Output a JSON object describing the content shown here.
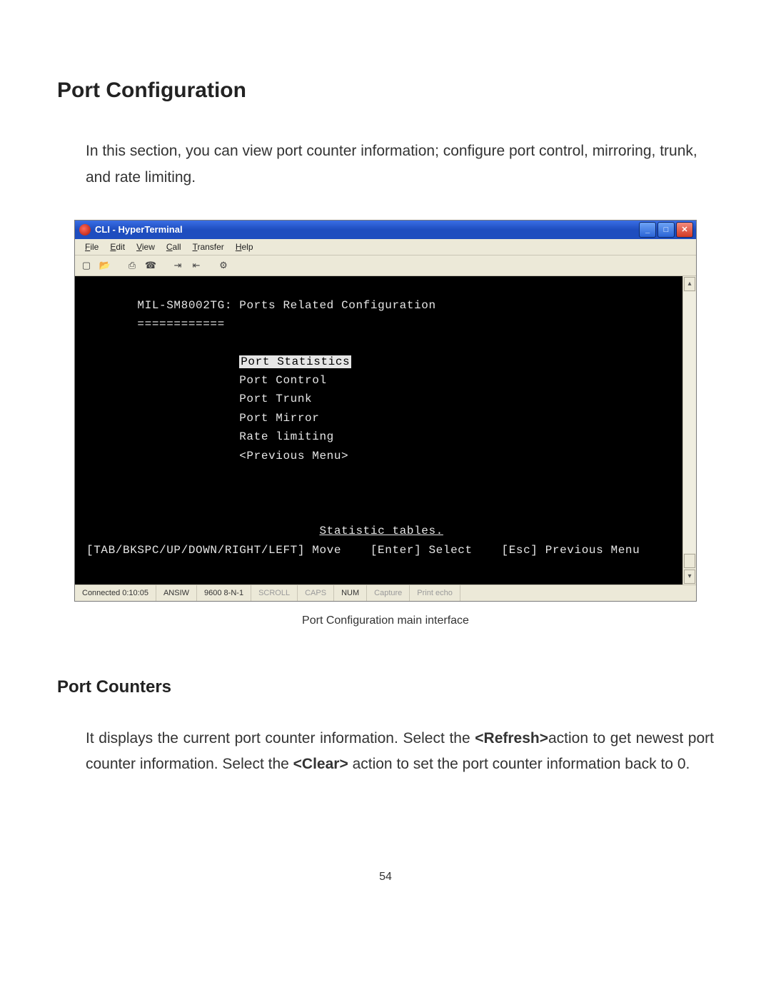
{
  "doc": {
    "section_title": "Port Configuration",
    "intro_paragraph": "In this section, you can view port counter information; configure port control, mirroring, trunk, and rate limiting.",
    "caption": "Port Configuration main interface",
    "sub_title": "Port Counters",
    "counters_before_refresh": "It displays the current port counter information. Select the ",
    "refresh_label": "<Refresh>",
    "counters_mid": "action to get newest port counter information. Select the ",
    "clear_label": "<Clear>",
    "counters_after_clear": " action to set the port counter information back to 0.",
    "page_number": "54"
  },
  "hyperterminal": {
    "window_title": "CLI - HyperTerminal",
    "menus": [
      "File",
      "Edit",
      "View",
      "Call",
      "Transfer",
      "Help"
    ],
    "toolbar_icons": [
      "new-file-icon",
      "open-folder-icon",
      "print-icon",
      "hangup-icon",
      "connect-icon",
      "disconnect-icon",
      "properties-icon"
    ],
    "win_buttons": {
      "minimize": "_",
      "maximize": "□",
      "close": "✕"
    },
    "terminal": {
      "header": "MIL-SM8002TG: Ports Related Configuration",
      "divider": "============",
      "menu_items": [
        {
          "label": "Port Statistics",
          "selected": true
        },
        {
          "label": "Port Control",
          "selected": false
        },
        {
          "label": "Port Trunk",
          "selected": false
        },
        {
          "label": "Port Mirror",
          "selected": false
        },
        {
          "label": "Rate limiting",
          "selected": false
        },
        {
          "label": "<Previous Menu>",
          "selected": false
        }
      ],
      "hint_line_center": "Statistic tables.",
      "nav_line": "[TAB/BKSPC/UP/DOWN/RIGHT/LEFT] Move    [Enter] Select    [Esc] Previous Menu"
    },
    "statusbar": {
      "connected": "Connected 0:10:05",
      "emulation": "ANSIW",
      "port_settings": "9600 8-N-1",
      "indicators": [
        "SCROLL",
        "CAPS",
        "NUM",
        "Capture",
        "Print echo"
      ],
      "indicator_active": {
        "SCROLL": false,
        "CAPS": false,
        "NUM": true,
        "Capture": false,
        "Print echo": false
      }
    }
  }
}
